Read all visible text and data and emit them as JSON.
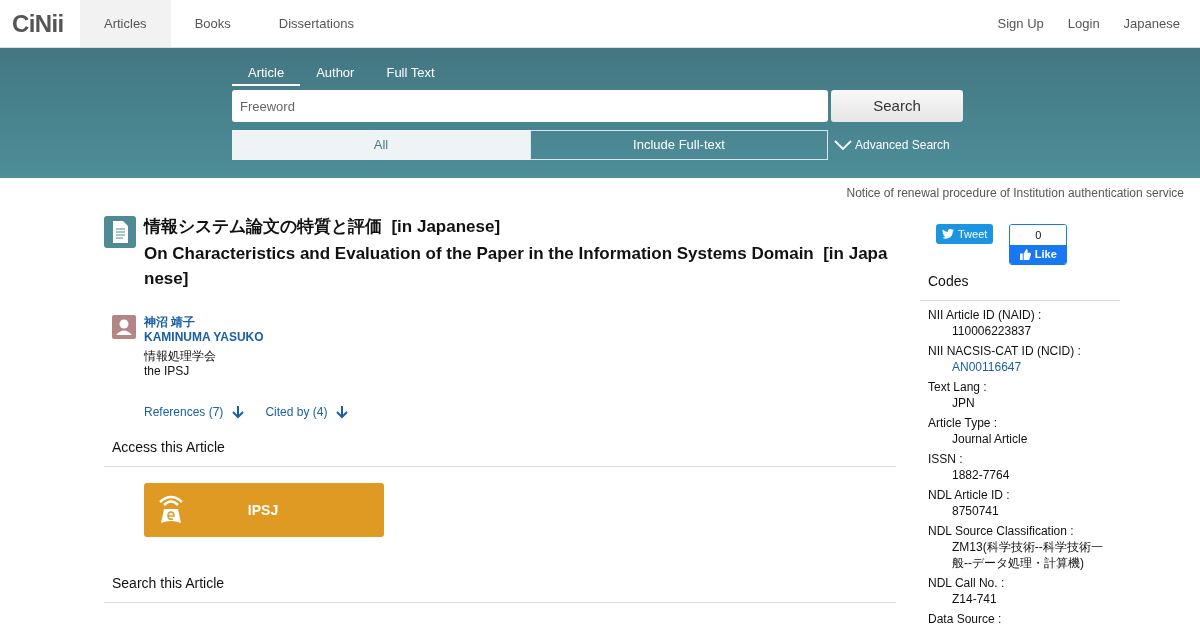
{
  "header": {
    "logo": "CiNii",
    "nav": [
      {
        "label": "Articles",
        "selected": true
      },
      {
        "label": "Books",
        "selected": false
      },
      {
        "label": "Dissertations",
        "selected": false
      }
    ],
    "links": [
      "Sign Up",
      "Login",
      "Japanese"
    ]
  },
  "search": {
    "tabs": [
      {
        "label": "Article",
        "selected": true
      },
      {
        "label": "Author",
        "selected": false
      },
      {
        "label": "Full Text",
        "selected": false
      }
    ],
    "placeholder": "Freeword",
    "button": "Search",
    "scopes": [
      {
        "label": "All",
        "selected": true
      },
      {
        "label": "Include Full-text",
        "selected": false
      }
    ],
    "advanced": "Advanced Search"
  },
  "notice": "Notice of renewal procedure of Institution authentication service",
  "article": {
    "title_ja": "情報システム論文の特質と評価  [in Japanese]",
    "title_en": "On Characteristics and Evaluation of the Paper in the Information Systems Domain  [in Japanese]",
    "authors": [
      {
        "name_ja": "神沼 靖子",
        "name_en": "KAMINUMA YASUKO"
      }
    ],
    "publisher_ja": "情報処理学会",
    "publisher_en": "the IPSJ",
    "references": "References (7)",
    "cited_by": "Cited by (4)"
  },
  "access": {
    "heading": "Access this Article",
    "button": "IPSJ"
  },
  "search_article": {
    "heading": "Search this Article"
  },
  "social": {
    "tweet": "Tweet",
    "like_count": "0",
    "like": "Like"
  },
  "codes": {
    "heading": "Codes",
    "items": [
      {
        "label": "NII Article ID (NAID) :",
        "value": "110006223837",
        "kind": "text"
      },
      {
        "label": "NII NACSIS-CAT ID (NCID) :",
        "value": "AN00116647",
        "kind": "link"
      },
      {
        "label": "Text Lang :",
        "value": "JPN",
        "kind": "text"
      },
      {
        "label": "Article Type :",
        "value": "Journal Article",
        "kind": "text"
      },
      {
        "label": "ISSN :",
        "value": "1882-7764",
        "kind": "text"
      },
      {
        "label": "NDL Article ID :",
        "value": "8750741",
        "kind": "text"
      },
      {
        "label": "NDL Source Classification :",
        "value": "ZM13(科学技術--科学技術一般--データ処理・計算機)",
        "kind": "text"
      },
      {
        "label": "NDL Call No. :",
        "value": "Z14-741",
        "kind": "text"
      },
      {
        "label": "Data Source :",
        "kind": "label"
      }
    ]
  }
}
